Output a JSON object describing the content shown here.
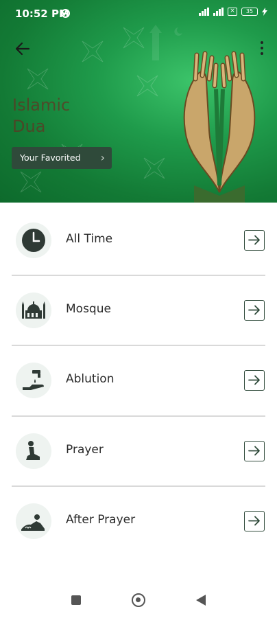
{
  "status_bar": {
    "time": "10:52 PM",
    "battery": "35"
  },
  "header": {
    "title_line1": "Islamic",
    "title_line2": "Dua",
    "favorites_button": "Your Favorited"
  },
  "items": [
    {
      "label": "All Time",
      "icon": "clock-icon"
    },
    {
      "label": "Mosque",
      "icon": "mosque-icon"
    },
    {
      "label": "Ablution",
      "icon": "ablution-icon"
    },
    {
      "label": "Prayer",
      "icon": "prayer-icon"
    },
    {
      "label": "After Prayer",
      "icon": "after-prayer-icon"
    }
  ],
  "colors": {
    "header_green": "#1f9b4b",
    "accent_dark": "#2f4a3a",
    "divider": "#d9d9d9"
  }
}
